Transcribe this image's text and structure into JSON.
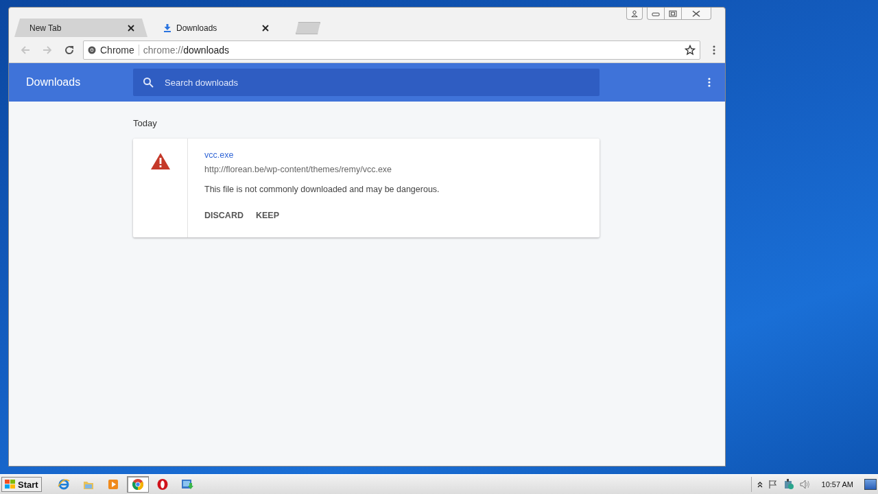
{
  "window": {
    "tabs": [
      {
        "title": "New Tab",
        "kind": "plain",
        "selected": false
      },
      {
        "title": "Downloads",
        "kind": "download",
        "selected": true
      }
    ]
  },
  "omnibox": {
    "chip": "Chrome",
    "scheme": "chrome://",
    "host": "downloads"
  },
  "page": {
    "title": "Downloads",
    "search": {
      "placeholder": "Search downloads"
    },
    "section": "Today",
    "items": [
      {
        "kind": "dangerous",
        "name": "vcc.exe",
        "url": "http://florean.be/wp-content/themes/remy/vcc.exe",
        "warning": "This file is not commonly downloaded and may be dangerous.",
        "actions": [
          "DISCARD",
          "KEEP"
        ]
      }
    ]
  },
  "taskbar": {
    "start": "Start",
    "apps": [
      {
        "kind": "ie",
        "selected": false
      },
      {
        "kind": "folder",
        "selected": false
      },
      {
        "kind": "media",
        "selected": false
      },
      {
        "kind": "chrome",
        "selected": true
      },
      {
        "kind": "opera",
        "selected": false
      },
      {
        "kind": "installer",
        "selected": false
      }
    ],
    "clock": "10:57 AM"
  }
}
